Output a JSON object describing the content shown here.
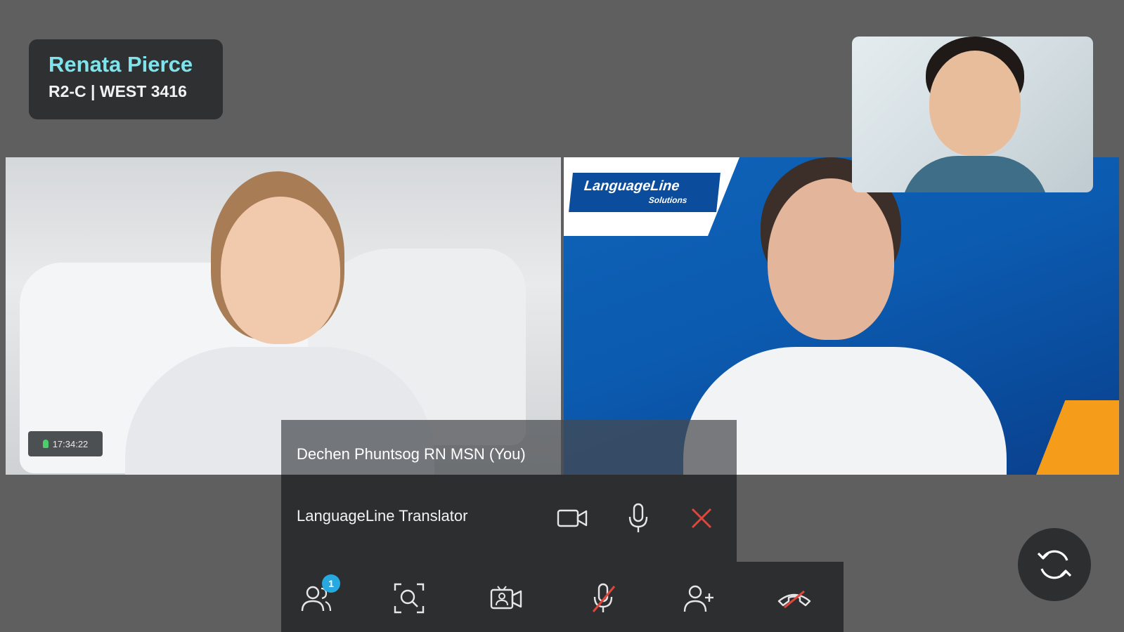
{
  "patient": {
    "name": "Renata Pierce",
    "room": "R2-C | WEST 3416"
  },
  "patient_video": {
    "timer": "17:34:22",
    "self_label": "Dechen Phuntsog RN MSN (You)"
  },
  "interpreter_video": {
    "logo_main": "LanguageLine",
    "logo_sub": "Solutions"
  },
  "translator_bar": {
    "label": "LanguageLine Translator"
  },
  "toolbar": {
    "participants_badge": "1"
  },
  "colors": {
    "background": "#5f5f5f",
    "panel": "#2d2e30",
    "accent_cyan": "#7fe3ec",
    "badge_blue": "#25a9e0",
    "end_red": "#e0463c",
    "orange": "#f59c1a"
  }
}
